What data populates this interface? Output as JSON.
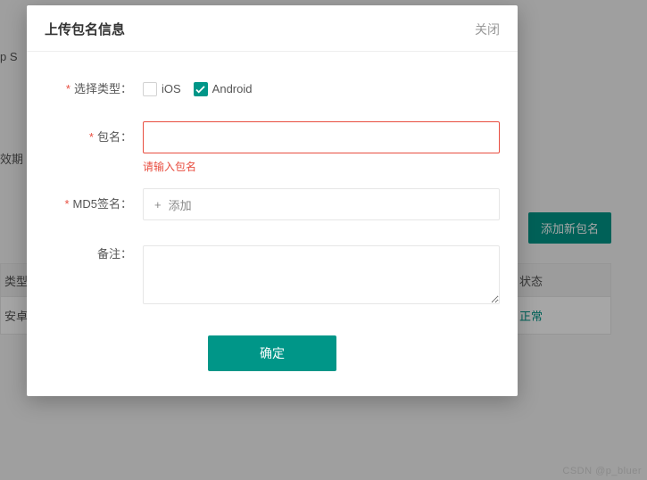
{
  "modal": {
    "title": "上传包名信息",
    "close_label": "关闭",
    "fields": {
      "type_label": "选择类型：",
      "ios_label": "iOS",
      "android_label": "Android",
      "package_label": "包名：",
      "package_error": "请输入包名",
      "md5_label": "MD5签名：",
      "add_label": "添加",
      "remark_label": "备注："
    },
    "confirm_label": "确定"
  },
  "background": {
    "app_label": "p S",
    "expire_label": "效期",
    "add_btn_label": "添加新包名",
    "col_type": "类型",
    "col_status": "状态",
    "row_type": "安卓",
    "row_status": "正常"
  },
  "watermark": "CSDN @p_bluer"
}
